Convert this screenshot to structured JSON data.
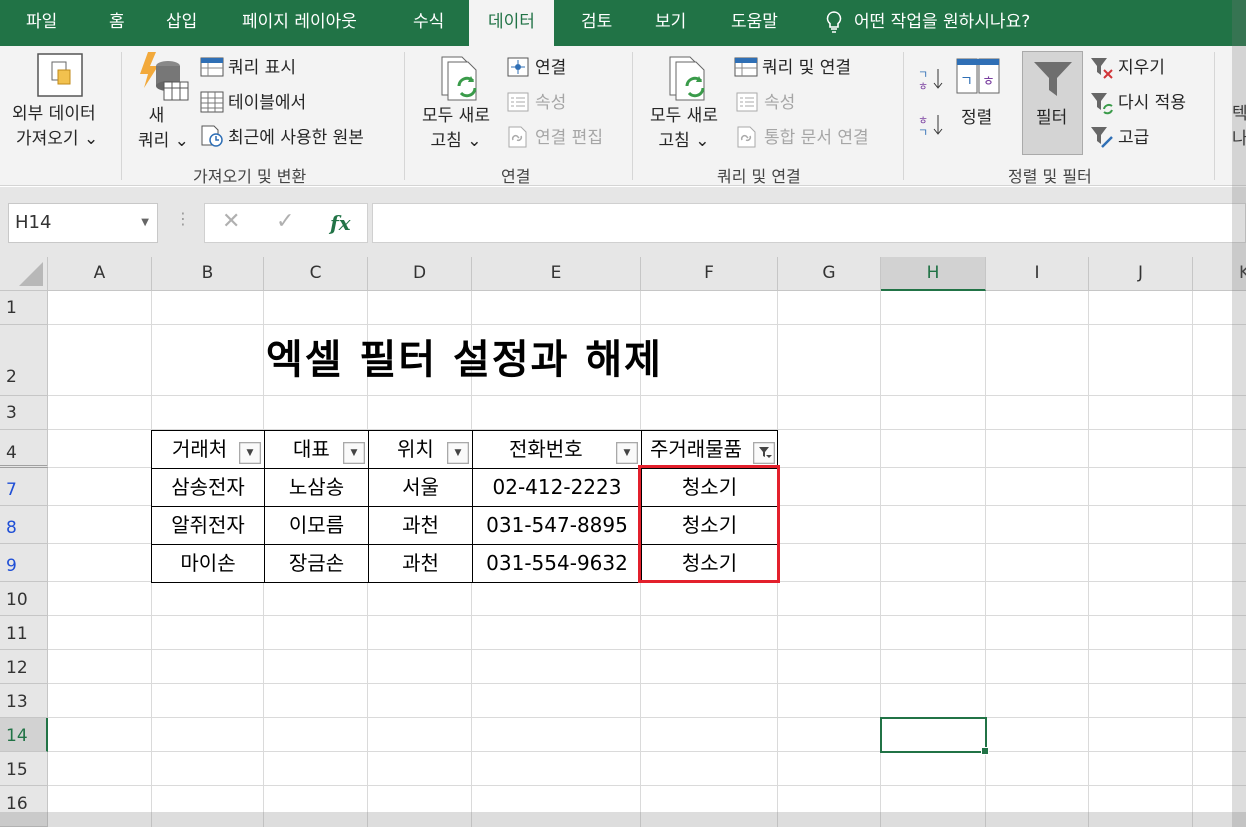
{
  "tabs": [
    "파일",
    "홈",
    "삽입",
    "페이지 레이아웃",
    "수식",
    "데이터",
    "검토",
    "보기",
    "도움말"
  ],
  "active_tab": "데이터",
  "tell_me": "어떤 작업을 원하시나요?",
  "ribbon": {
    "get_external": [
      "외부 데이터",
      "가져오기 ⌄"
    ],
    "new_query": [
      "새",
      "쿼리 ⌄"
    ],
    "show_queries": "쿼리 표시",
    "from_table": "테이블에서",
    "recent_sources": "최근에 사용한 원본",
    "group_get_transform": "가져오기 및 변환",
    "refresh_all": [
      "모두 새로",
      "고침 ⌄"
    ],
    "connections": "연결",
    "properties": "속성",
    "edit_links": "연결 편집",
    "group_connections": "연결",
    "refresh_all2": [
      "모두 새로",
      "고침 ⌄"
    ],
    "queries_connections": "쿼리 및 연결",
    "properties2": "속성",
    "edit_links2": "통합 문서 연결",
    "group_queries": "쿼리 및 연결",
    "sort": "정렬",
    "filter": "필터",
    "clear": "지우기",
    "reapply": "다시 적용",
    "advanced": "고급",
    "group_sort_filter": "정렬 및 필터",
    "cut_text": [
      "텍",
      "나"
    ]
  },
  "name_box": "H14",
  "fx": "fx",
  "columns": [
    "A",
    "B",
    "C",
    "D",
    "E",
    "F",
    "G",
    "H",
    "I",
    "J",
    "K"
  ],
  "rows": [
    "1",
    "2",
    "3",
    "4",
    "7",
    "8",
    "9",
    "10",
    "11",
    "12",
    "13",
    "14",
    "15",
    "16"
  ],
  "sheet_title": "엑셀 필터 설정과 해제",
  "table": {
    "headers": [
      "거래처",
      "대표",
      "위치",
      "전화번호",
      "주거래물품"
    ],
    "rows": [
      [
        "삼송전자",
        "노삼송",
        "서울",
        "02-412-2223",
        "청소기"
      ],
      [
        "알쥐전자",
        "이모름",
        "과천",
        "031-547-8895",
        "청소기"
      ],
      [
        "마이손",
        "장금손",
        "과천",
        "031-554-9632",
        "청소기"
      ]
    ]
  },
  "colors": {
    "excel_green": "#217346",
    "highlight_red": "#e3202c",
    "row_link_blue": "#1f4fd6"
  }
}
